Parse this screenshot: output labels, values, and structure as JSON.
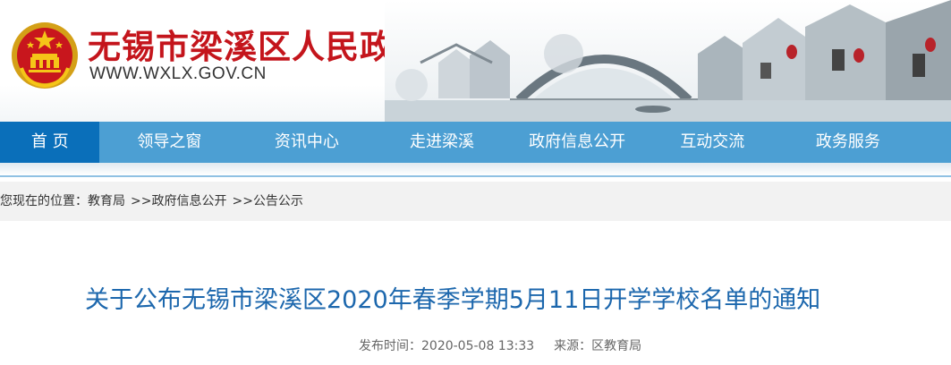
{
  "header": {
    "site_name": "无锡市梁溪区人民政府",
    "site_url": "WWW.WXLX.GOV.CN",
    "emblem_icon": "national-emblem-icon",
    "colors": {
      "brand_red": "#c4151c",
      "nav_blue": "#4c9fd3",
      "nav_active": "#0a6fba",
      "title_blue": "#1c67ad"
    }
  },
  "nav": {
    "items": [
      {
        "label": "首 页"
      },
      {
        "label": "领导之窗"
      },
      {
        "label": "资讯中心"
      },
      {
        "label": "走进梁溪"
      },
      {
        "label": "政府信息公开"
      },
      {
        "label": "互动交流"
      },
      {
        "label": "政务服务"
      }
    ]
  },
  "breadcrumb": {
    "prefix": "您现在的位置：",
    "items": [
      "教育局",
      "政府信息公开",
      "公告公示"
    ],
    "separator": ">>"
  },
  "article": {
    "title": "关于公布无锡市梁溪区2020年春季学期5月11日开学学校名单的通知",
    "publish_time_label": "发布时间：",
    "publish_time": "2020-05-08 13:33",
    "source_label": "来源：",
    "source": "区教育局"
  }
}
